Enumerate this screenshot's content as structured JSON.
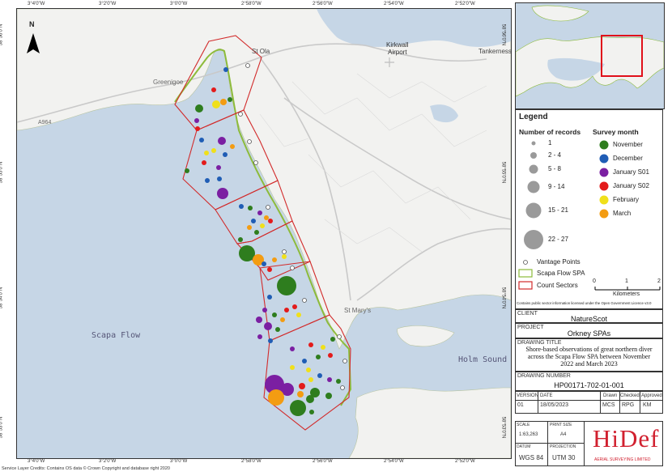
{
  "colors": {
    "sea": "#c6d6e6",
    "land": "#f2f2f0",
    "sector_line": "#d22b2b",
    "spa_line": "#8dbb3b",
    "inset_box": "#e0101a",
    "hidef_red": "#d1202f"
  },
  "map": {
    "lat_ticks": [
      "58°56'0\"N",
      "58°55'0\"N",
      "58°54'0\"N",
      "58°53'0\"N"
    ],
    "lon_ticks": [
      "3°4'0\"W",
      "3°2'0\"W",
      "3°0'0\"W",
      "2°58'0\"W",
      "2°56'0\"W",
      "2°54'0\"W",
      "2°52'0\"W"
    ],
    "place_labels": {
      "kirkwall_airport": "Kirkwall\nAirport",
      "tankerness": "Tankerness",
      "st_ola": "St Ola",
      "greenigoe": "Greenigoe",
      "a964": "A964",
      "st_marys": "St Mary's",
      "scapa_flow": "Scapa Flow",
      "holm_sound": "Holm Sound"
    },
    "north_label": "N",
    "service_credits": "Service Layer Credits: Contains OS data © Crown Copyright and database right 2020"
  },
  "legend": {
    "title": "Legend",
    "records_heading": "Number of records",
    "survey_heading": "Survey month",
    "record_classes": [
      "1",
      "2 - 4",
      "5 - 8",
      "9 - 14",
      "15 - 21",
      "22 - 27"
    ],
    "months": [
      {
        "name": "November",
        "color": "#2e7d1e"
      },
      {
        "name": "December",
        "color": "#1f5db5"
      },
      {
        "name": "January S01",
        "color": "#7b1fa2"
      },
      {
        "name": "January S02",
        "color": "#e31b1b"
      },
      {
        "name": "February",
        "color": "#f0e01a"
      },
      {
        "name": "March",
        "color": "#f39c12"
      }
    ],
    "vantage_points": "Vantage Points",
    "scapa_spa": "Scapa Flow SPA",
    "count_sectors": "Count Sectors",
    "scale_ticks": [
      "0",
      "1",
      "2"
    ],
    "scale_unit": "Kilometers",
    "licence": "Contains public sector information licensed under the Open Government Licence v3.0"
  },
  "title_block": {
    "client_label": "CLIENT",
    "client": "NatureScot",
    "project_label": "PROJECT",
    "project": "Orkney SPAs",
    "drawing_title_label": "DRAWING TITLE",
    "drawing_title": "Shore-based observations of great northern diver across the Scapa Flow SPA between November 2022 and March 2023",
    "drawing_number_label": "DRAWING NUMBER",
    "drawing_number": "HP00171-702-01-001",
    "version_label": "VERSION",
    "version": "01",
    "date_label": "DATE",
    "date": "18/05/2023",
    "drawn_label": "Drawn",
    "drawn": "MCS",
    "checked_label": "Checked",
    "checked": "RPG",
    "approved_label": "Approved",
    "approved": "KM",
    "scale_label": "SCALE",
    "scale": "1:63,263",
    "print_size_label": "PRINT SIZE",
    "print_size": "A4",
    "datum_label": "DATUM",
    "datum": "WGS 84",
    "projection_label": "PROJECTION",
    "projection": "UTM 30",
    "logo_text": "HiDef",
    "logo_sub": "AERIAL SURVEYING LIMITED"
  },
  "observations": [
    {
      "month": "November",
      "count": 1
    },
    {
      "month": "December",
      "count": 1
    },
    {
      "month": "January S01",
      "count": 5
    },
    {
      "month": "February",
      "count": 3
    },
    {
      "month": "March",
      "count": 1
    },
    {
      "month": "November",
      "count": 27
    },
    {
      "month": "November",
      "count": 20
    },
    {
      "month": "March",
      "count": 9
    },
    {
      "month": "January S01",
      "count": 22
    },
    {
      "month": "November",
      "count": 15
    },
    {
      "month": "March",
      "count": 14
    }
  ]
}
